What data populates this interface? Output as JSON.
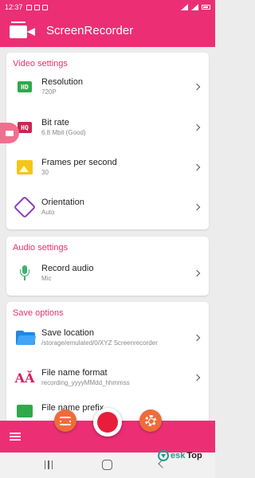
{
  "status_bar": {
    "time": "12:37"
  },
  "app": {
    "title": "ScreenRecorder",
    "accent": "#ec2f74"
  },
  "video_settings": {
    "title": "Video settings",
    "items": [
      {
        "label": "Resolution",
        "value": "720P",
        "icon": "hd-icon",
        "icon_text": "HD",
        "icon_color": "#2eaa4a"
      },
      {
        "label": "Bit rate",
        "value": "6.8 Mbit (Good)",
        "icon": "bitrate-icon",
        "icon_text": "HQ",
        "icon_color": "#c62750"
      },
      {
        "label": "Frames per second",
        "value": "30",
        "icon": "image-icon",
        "icon_color": "#f5c518"
      },
      {
        "label": "Orientation",
        "value": "Auto",
        "icon": "rotate-icon",
        "icon_color": "#8b3bb8"
      }
    ]
  },
  "audio_settings": {
    "title": "Audio settings",
    "items": [
      {
        "label": "Record audio",
        "value": "Mic",
        "icon": "mic-icon",
        "icon_color": "#3cb371"
      }
    ]
  },
  "save_options": {
    "title": "Save options",
    "items": [
      {
        "label": "Save location",
        "value": "/storage/emulated/0/XYZ Screenrecorder",
        "icon": "folder-icon",
        "icon_color": "#1e88e5"
      },
      {
        "label": "File name format",
        "value": "recording_yyyyMMdd_hhmmss",
        "icon": "font-icon",
        "icon_text": "AĂ",
        "icon_color": "#d81b60"
      },
      {
        "label": "File name prefix",
        "icon": "prefix-icon"
      }
    ]
  },
  "watermark": {
    "text": "esk",
    "text_tail": "Top"
  }
}
